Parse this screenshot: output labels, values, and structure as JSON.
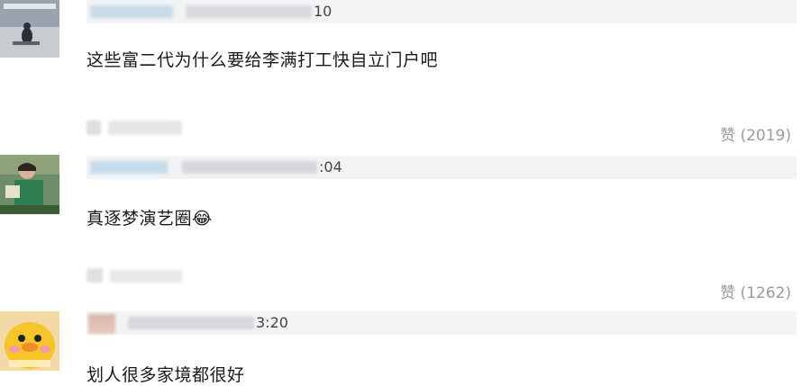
{
  "comments": [
    {
      "time_suffix": "10",
      "text": "这些富二代为什么要给李满打工快自立门户吧",
      "like_label": "赞 (2019)"
    },
    {
      "time_suffix": ":04",
      "text": "真逐梦演艺圈",
      "emoji": "😂",
      "like_label": "赞 (1262)"
    },
    {
      "time_suffix": "3:20",
      "text": "划人很多家境都很好"
    }
  ],
  "colors": {
    "meta_bar": "#f1f3f5",
    "like_text": "#9a9a9a",
    "content_text": "#1a1a1a"
  }
}
